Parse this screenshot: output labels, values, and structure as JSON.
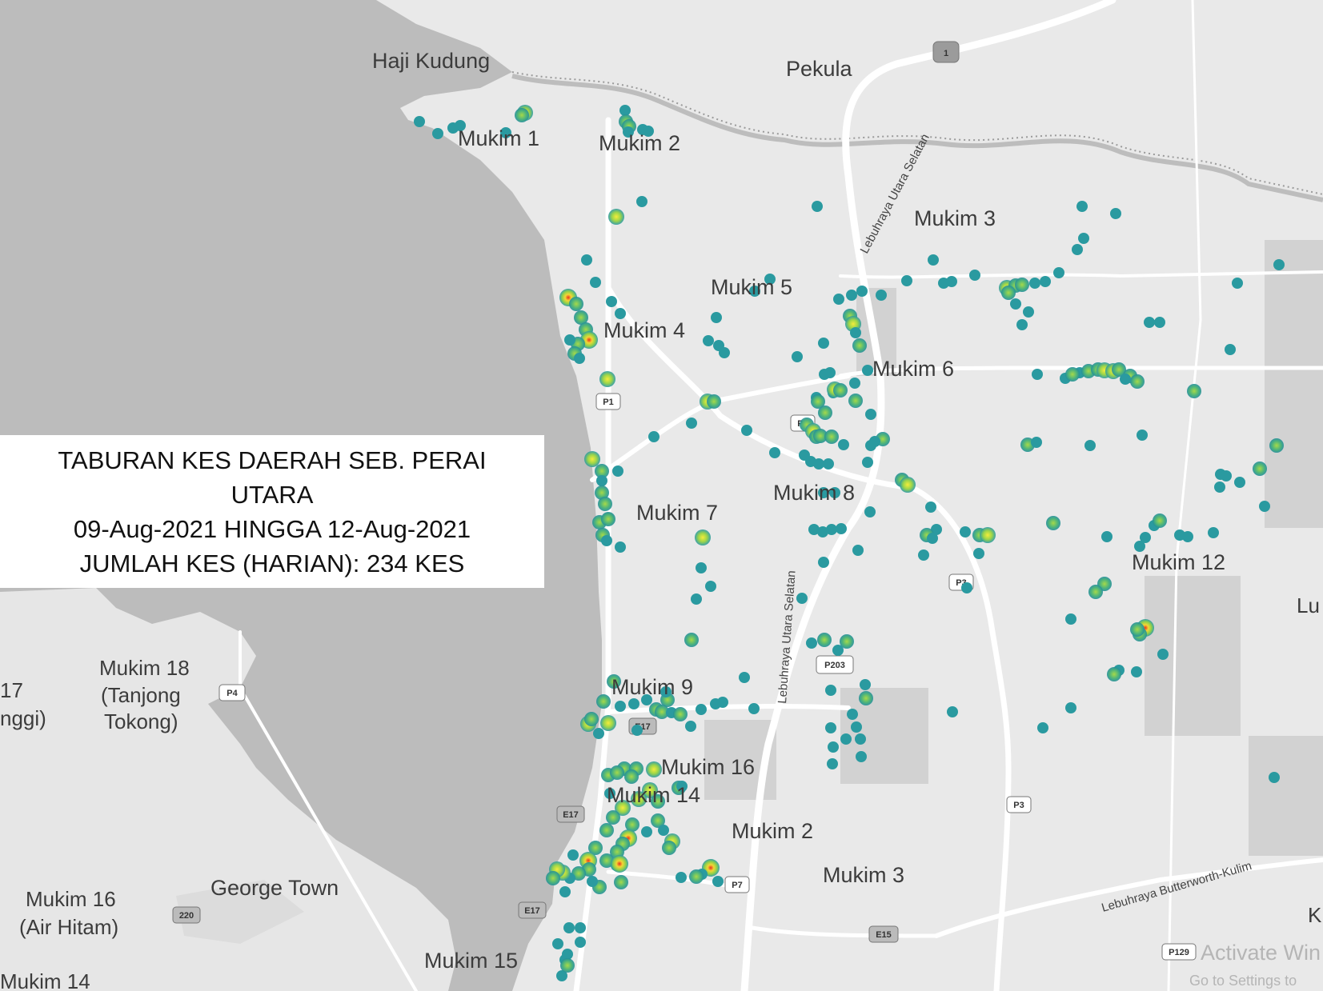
{
  "title": {
    "line1": "TABURAN KES DAERAH SEB. PERAI",
    "line2": "UTARA",
    "line3": "09-Aug-2021 HINGGA 12-Aug-2021",
    "line4": "JUMLAH KES (HARIAN):  234 KES"
  },
  "places": {
    "haji_kudung": "Haji Kudung",
    "pekula": "Pekula",
    "mukim1": "Mukim 1",
    "mukim2_n": "Mukim 2",
    "mukim3_n": "Mukim 3",
    "mukim4": "Mukim 4",
    "mukim5": "Mukim 5",
    "mukim6": "Mukim 6",
    "mukim7": "Mukim 7",
    "mukim8": "Mukim 8",
    "mukim9": "Mukim 9",
    "mukim12": "Mukim 12",
    "mukim14": "Mukim 14",
    "mukim15": "Mukim 15",
    "mukim16": "Mukim 16",
    "mukim2_s": "Mukim 2",
    "mukim3_s": "Mukim 3",
    "mukim18": "Mukim 18",
    "tanjong": "(Tanjong",
    "tokong": "Tokong)",
    "george_town": "George Town",
    "mukim16_ah": "Mukim 16",
    "air_hitam": "(Air Hitam)",
    "mukim14_w": "Mukim 14",
    "edge_17": "17",
    "edge_nggi": "nggi)",
    "edge_lu": "Lu",
    "edge_k": "K"
  },
  "roads": {
    "lus_north": "Lebuhraya Utara Selatan",
    "lus_south": "Lebuhraya Utara Selatan",
    "butterworth_kulim": "Lebuhraya Butterworth-Kulim"
  },
  "shields": {
    "r1": "1",
    "p1": "P1",
    "p5": "P5",
    "p3a": "P3",
    "p203": "P203",
    "e17a": "E17",
    "e17b": "E17",
    "e17c": "E17",
    "p4": "P4",
    "p3b": "P3",
    "p7": "P7",
    "e15": "E15",
    "r220": "220",
    "p129": "P129"
  },
  "watermark": {
    "line1": "Activate Win",
    "line2": "Go to Settings to"
  },
  "colors": {
    "water": "#bcbcbc",
    "land": "#e8e8e8",
    "road": "#ffffff",
    "point": "#1f8f9a",
    "hot_yellow": "#d7ef3a",
    "hot_red": "#e8321e"
  },
  "legend_note": "",
  "case_points_total": 234
}
